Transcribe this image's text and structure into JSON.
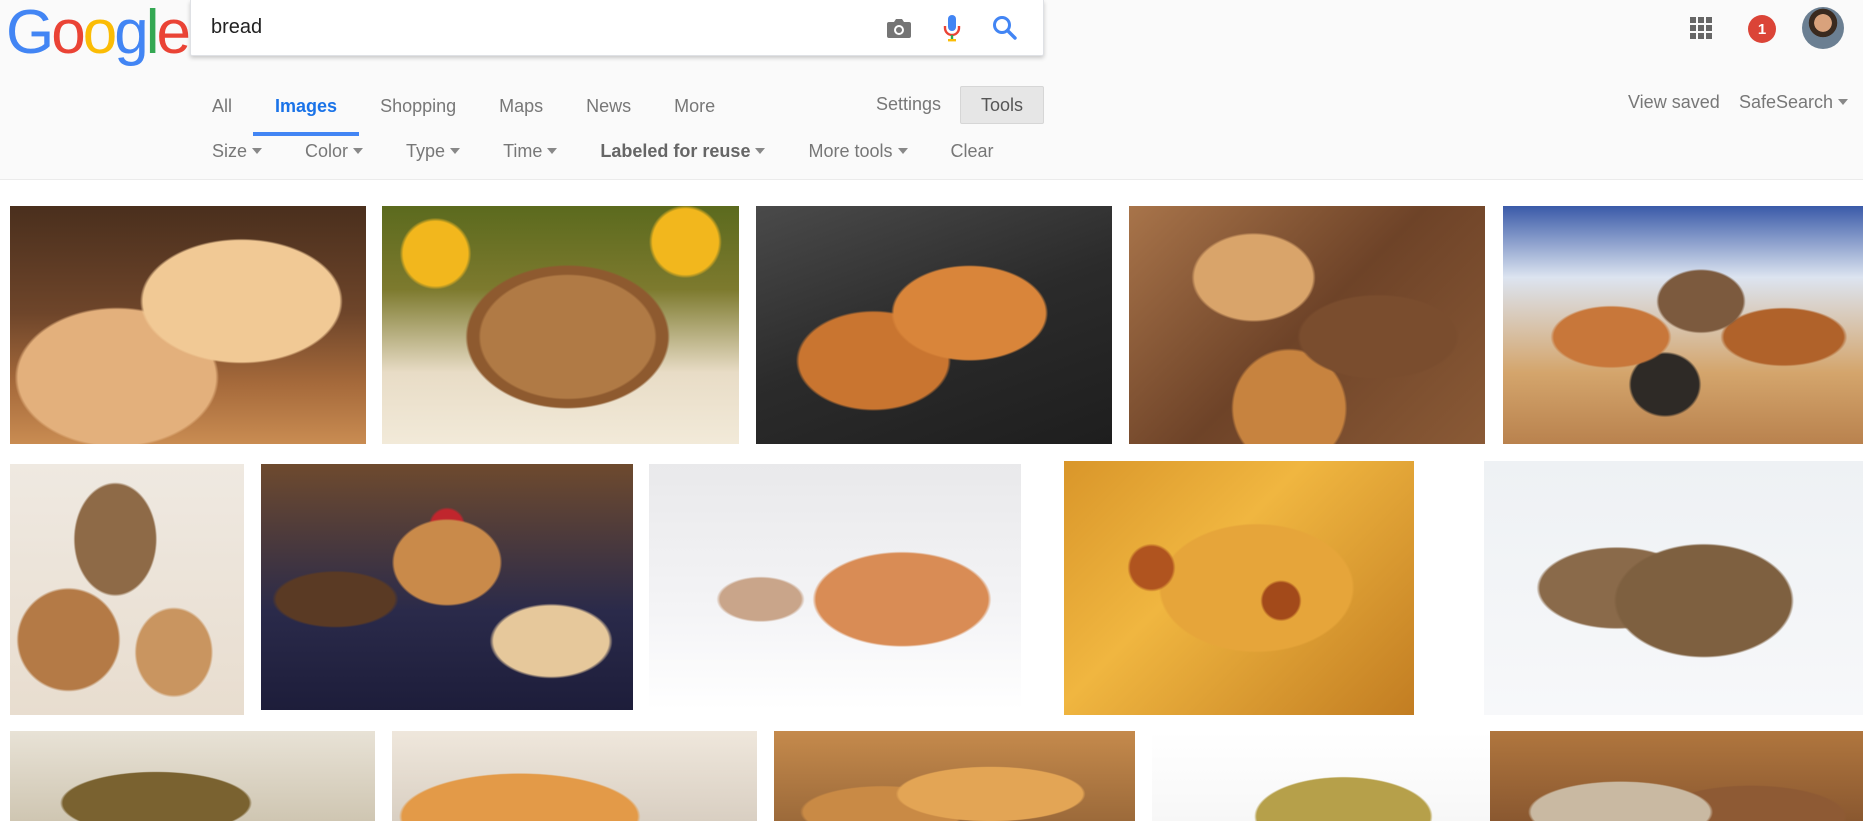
{
  "logo": {
    "letters": [
      "G",
      "o",
      "o",
      "g",
      "l",
      "e"
    ],
    "colors": [
      "#4285f4",
      "#ea4335",
      "#fbbc05",
      "#4285f4",
      "#34a853",
      "#ea4335"
    ]
  },
  "search": {
    "query": "bread",
    "camera_icon": "camera-icon",
    "mic_icon": "microphone-icon",
    "search_icon": "search-icon"
  },
  "tabs": [
    {
      "label": "All"
    },
    {
      "label": "Images"
    },
    {
      "label": "Shopping"
    },
    {
      "label": "Maps"
    },
    {
      "label": "News"
    },
    {
      "label": "More"
    }
  ],
  "settings_label": "Settings",
  "tools_label": "Tools",
  "view_saved_label": "View saved",
  "safesearch_label": "SafeSearch",
  "tools": [
    {
      "label": "Size"
    },
    {
      "label": "Color"
    },
    {
      "label": "Type"
    },
    {
      "label": "Time"
    },
    {
      "label": "Labeled for reuse"
    },
    {
      "label": "More tools"
    },
    {
      "label": "Clear"
    }
  ],
  "notifications": {
    "count": "1"
  },
  "icons": {
    "apps": "apps-grid-icon",
    "account": "account-avatar"
  },
  "colors": {
    "accent": "#4285f4",
    "active_tab": "#1a73e8",
    "notification": "#db4437"
  }
}
